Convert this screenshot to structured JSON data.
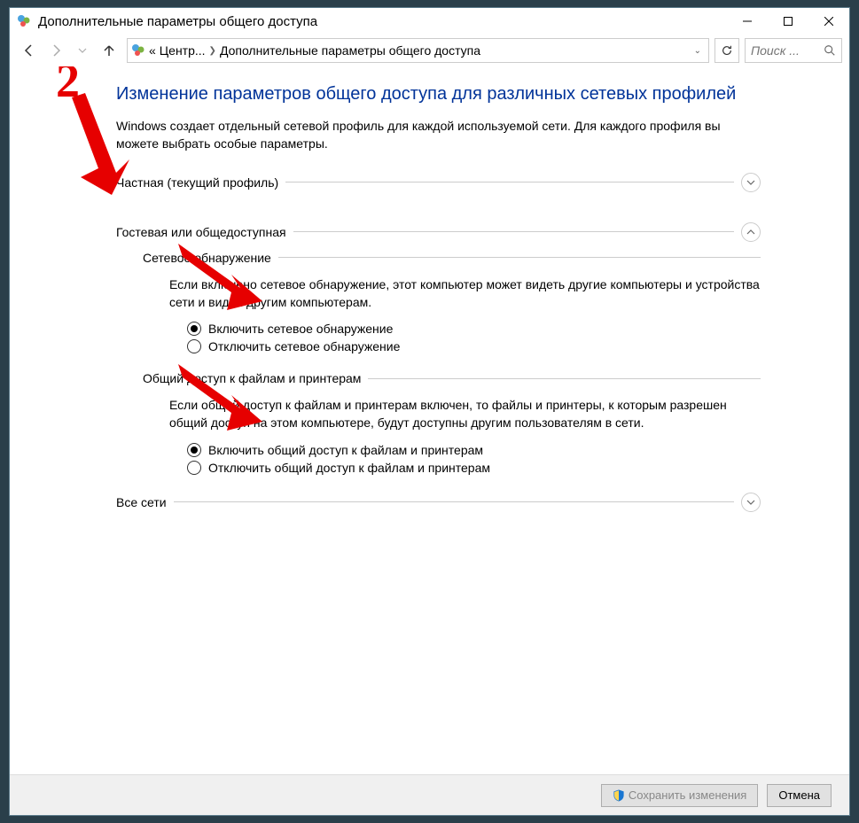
{
  "window": {
    "title": "Дополнительные параметры общего доступа"
  },
  "nav": {
    "crumb1_prefix": "«",
    "crumb1": "Центр...",
    "crumb2": "Дополнительные параметры общего доступа",
    "search_placeholder": "Поиск ..."
  },
  "page": {
    "title": "Изменение параметров общего доступа для различных сетевых профилей",
    "desc": "Windows создает отдельный сетевой профиль для каждой используемой сети. Для каждого профиля вы можете выбрать особые параметры."
  },
  "sections": {
    "private": {
      "label": "Частная (текущий профиль)"
    },
    "guest": {
      "label": "Гостевая или общедоступная",
      "discovery": {
        "title": "Сетевое обнаружение",
        "desc": "Если включено сетевое обнаружение, этот компьютер может видеть другие компьютеры и устройства сети и виден другим компьютерам.",
        "opt_on": "Включить сетевое обнаружение",
        "opt_off": "Отключить сетевое обнаружение"
      },
      "sharing": {
        "title": "Общий доступ к файлам и принтерам",
        "desc": "Если общий доступ к файлам и принтерам включен, то файлы и принтеры, к которым разрешен общий доступ на этом компьютере, будут доступны другим пользователям в сети.",
        "opt_on": "Включить общий доступ к файлам и принтерам",
        "opt_off": "Отключить общий доступ к файлам и принтерам"
      }
    },
    "all": {
      "label": "Все сети"
    }
  },
  "footer": {
    "save": "Сохранить изменения",
    "cancel": "Отмена"
  },
  "annotation": {
    "num": "2"
  }
}
